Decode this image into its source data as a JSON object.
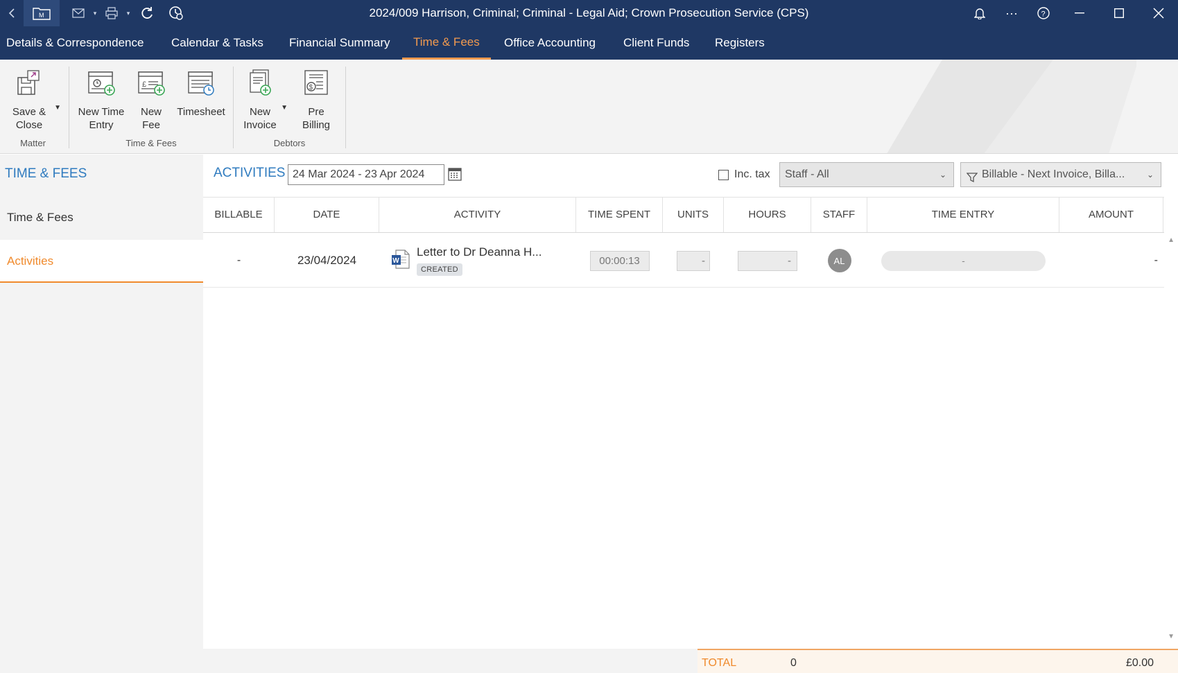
{
  "window": {
    "title": "2024/009 Harrison, Criminal; Criminal - Legal Aid; Crown Prosecution Service (CPS)"
  },
  "nav": {
    "tabs": [
      {
        "label": "Details & Correspondence"
      },
      {
        "label": "Calendar & Tasks"
      },
      {
        "label": "Financial Summary"
      },
      {
        "label": "Time & Fees"
      },
      {
        "label": "Office Accounting"
      },
      {
        "label": "Client Funds"
      },
      {
        "label": "Registers"
      }
    ],
    "active": "Time & Fees"
  },
  "ribbon": {
    "save_close": "Save &\nClose",
    "new_time_entry": "New Time\nEntry",
    "new_fee": "New\nFee",
    "timesheet": "Timesheet",
    "new_invoice": "New\nInvoice",
    "pre_billing": "Pre\nBilling",
    "groups": {
      "matter": "Matter",
      "time_fees": "Time & Fees",
      "debtors": "Debtors"
    }
  },
  "left_panel": {
    "heading": "TIME & FEES",
    "items": [
      {
        "label": "Time & Fees"
      },
      {
        "label": "Activities"
      }
    ],
    "active": "Activities"
  },
  "activities": {
    "heading": "ACTIVITIES",
    "date_range": "24 Mar 2024 - 23 Apr 2024",
    "inc_tax_label": "Inc. tax",
    "staff_filter": "Staff - All",
    "billable_filter": "Billable - Next Invoice, Billa..."
  },
  "table": {
    "columns": [
      "BILLABLE",
      "DATE",
      "ACTIVITY",
      "TIME SPENT",
      "UNITS",
      "HOURS",
      "STAFF",
      "TIME ENTRY",
      "AMOUNT"
    ],
    "rows": [
      {
        "billable": "-",
        "date": "23/04/2024",
        "activity_title": "Letter to Dr Deanna H...",
        "activity_status": "CREATED",
        "activity_icon": "word-document-icon",
        "time_spent": "00:00:13",
        "units": "-",
        "hours": "-",
        "staff_initials": "AL",
        "time_entry": "-",
        "amount": "-"
      }
    ]
  },
  "footer": {
    "total_label": "TOTAL",
    "total_count": "0",
    "total_amount": "£0.00"
  },
  "colors": {
    "navy": "#1f3864",
    "accent_orange": "#f08a2c",
    "heading_blue": "#2f7bbf"
  }
}
